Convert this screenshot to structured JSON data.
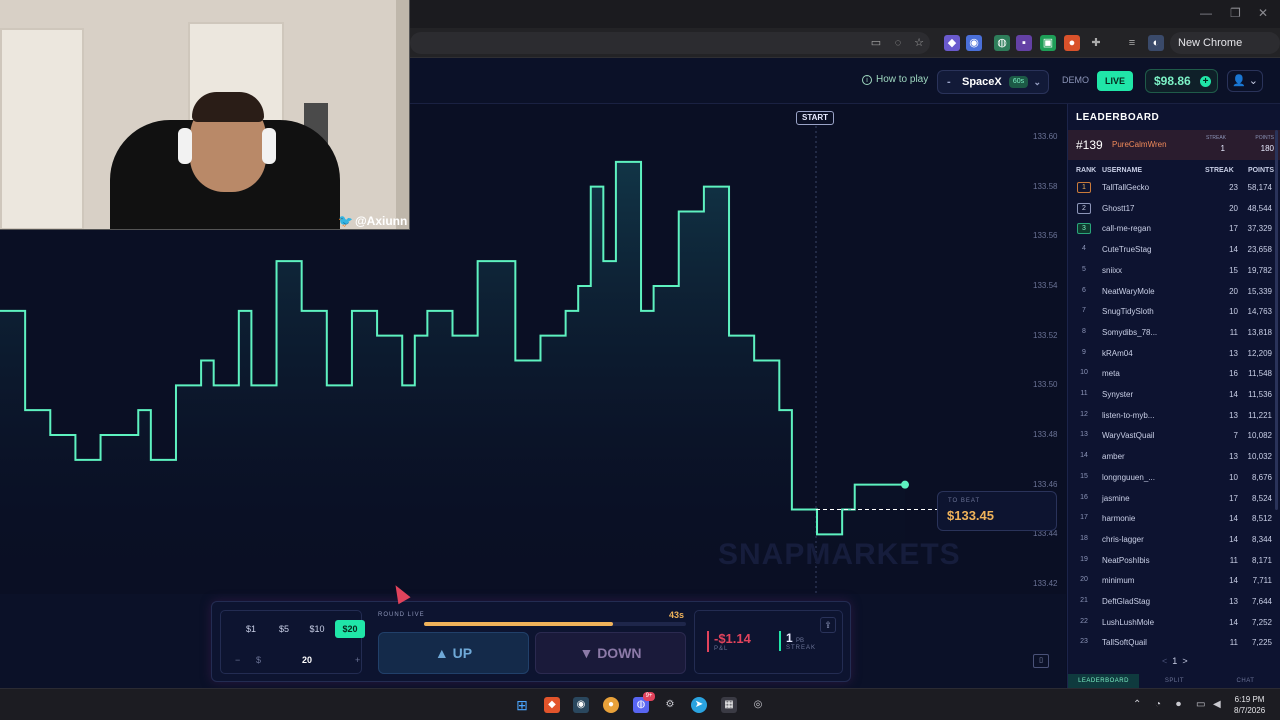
{
  "browser": {
    "new_chrome_label": "New Chrome available",
    "menu_glyph": "⋮"
  },
  "header": {
    "how_to_play": "How to play",
    "market": {
      "name": "SpaceX",
      "timeframe": "60s",
      "dash": "-",
      "chevron": "⌄"
    },
    "mode_demo": "DEMO",
    "mode_live": "LIVE",
    "balance": "$98.86",
    "balance_plus": "+",
    "profile_glyph": "👤 ⌄",
    "how_to_glyph": "i"
  },
  "chart": {
    "start_label": "START",
    "y_ticks": [
      "133.60",
      "133.58",
      "133.56",
      "133.54",
      "133.52",
      "133.50",
      "133.48",
      "133.46",
      "133.44",
      "133.42"
    ],
    "to_beat_label": "TO BEAT",
    "to_beat_value": "$133.45",
    "watermark": "SNAPMARKETS",
    "colors": {
      "line": "#5ef2c0",
      "area": "#0f2e3a",
      "target": "#ffffff"
    }
  },
  "chart_data": {
    "type": "line",
    "ylim": [
      133.42,
      133.6
    ],
    "series": [
      {
        "values": [
          133.53,
          133.53,
          133.49,
          133.49,
          133.48,
          133.48,
          133.47,
          133.47,
          133.48,
          133.48,
          133.48,
          133.49,
          133.47,
          133.47,
          133.5,
          133.5,
          133.51,
          133.5,
          133.5,
          133.53,
          133.5,
          133.5,
          133.55,
          133.55,
          133.53,
          133.53,
          133.5,
          133.5,
          133.53,
          133.53,
          133.52,
          133.52,
          133.5,
          133.52,
          133.53,
          133.53,
          133.52,
          133.52,
          133.55,
          133.55,
          133.55,
          133.51,
          133.51,
          133.52,
          133.52,
          133.53,
          133.54,
          133.58,
          133.55,
          133.59,
          133.59,
          133.53,
          133.54,
          133.54,
          133.57,
          133.57,
          133.58,
          133.58,
          133.52,
          133.52,
          133.51,
          133.51,
          133.49,
          133.45,
          133.45,
          133.44,
          133.44,
          133.45,
          133.46,
          133.46,
          133.46,
          133.46,
          133.46
        ]
      }
    ]
  },
  "webcam": {
    "handle": "@Axiunn",
    "bird": "🐦"
  },
  "trade": {
    "amounts": [
      "$1",
      "$5",
      "$10",
      "$20"
    ],
    "active_amount_index": 3,
    "stepper": {
      "minus": "−",
      "currency": "$",
      "value": "20",
      "plus": "+"
    },
    "round_label": "ROUND LIVE",
    "timer": "43s",
    "progress": 0.72,
    "up_label": "▲ UP",
    "down_label": "▼ DOWN",
    "pnl_value": "-$1.14",
    "pnl_label": "P&L",
    "streak_value": "1",
    "streak_unit": "PB",
    "streak_label": "STREAK",
    "share_glyph": "⇪",
    "panel_toggle_glyph": "▯"
  },
  "leaderboard": {
    "title": "LEADERBOARD",
    "me": {
      "rank": "#139",
      "username": "PureCalmWren",
      "streak_label": "STREAK",
      "streak": "1",
      "points_label": "POINTS",
      "points": "180"
    },
    "columns": [
      "RANK",
      "USERNAME",
      "STREAK",
      "POINTS"
    ],
    "rows": [
      {
        "rank": "1",
        "username": "TallTallGecko",
        "streak": "23",
        "points": "58,174"
      },
      {
        "rank": "2",
        "username": "Ghostt17",
        "streak": "20",
        "points": "48,544"
      },
      {
        "rank": "3",
        "username": "call-me-regan",
        "streak": "17",
        "points": "37,329"
      },
      {
        "rank": "4",
        "username": "CuteTrueStag",
        "streak": "14",
        "points": "23,658"
      },
      {
        "rank": "5",
        "username": "sniixx",
        "streak": "15",
        "points": "19,782"
      },
      {
        "rank": "6",
        "username": "NeatWaryMole",
        "streak": "20",
        "points": "15,339"
      },
      {
        "rank": "7",
        "username": "SnugTidySloth",
        "streak": "10",
        "points": "14,763"
      },
      {
        "rank": "8",
        "username": "Somydibs_78...",
        "streak": "11",
        "points": "13,818"
      },
      {
        "rank": "9",
        "username": "kRAm04",
        "streak": "13",
        "points": "12,209"
      },
      {
        "rank": "10",
        "username": "meta",
        "streak": "16",
        "points": "11,548"
      },
      {
        "rank": "11",
        "username": "Synyster",
        "streak": "14",
        "points": "11,536"
      },
      {
        "rank": "12",
        "username": "listen-to-myb...",
        "streak": "13",
        "points": "11,221"
      },
      {
        "rank": "13",
        "username": "WaryVastQuail",
        "streak": "7",
        "points": "10,082"
      },
      {
        "rank": "14",
        "username": "amber",
        "streak": "13",
        "points": "10,032"
      },
      {
        "rank": "15",
        "username": "longnguuen_...",
        "streak": "10",
        "points": "8,676"
      },
      {
        "rank": "16",
        "username": "jasmine",
        "streak": "17",
        "points": "8,524"
      },
      {
        "rank": "17",
        "username": "harmonie",
        "streak": "14",
        "points": "8,512"
      },
      {
        "rank": "18",
        "username": "chris-lagger",
        "streak": "14",
        "points": "8,344"
      },
      {
        "rank": "19",
        "username": "NeatPoshIbis",
        "streak": "11",
        "points": "8,171"
      },
      {
        "rank": "20",
        "username": "minimum",
        "streak": "14",
        "points": "7,711"
      },
      {
        "rank": "21",
        "username": "DeftGladStag",
        "streak": "13",
        "points": "7,644"
      },
      {
        "rank": "22",
        "username": "LushLushMole",
        "streak": "14",
        "points": "7,252"
      },
      {
        "rank": "23",
        "username": "TallSoftQuail",
        "streak": "11",
        "points": "7,225"
      }
    ],
    "pager": {
      "prev": "<",
      "page": "1",
      "next": ">"
    },
    "tabs": [
      "LEADERBOARD",
      "SPLIT",
      "CHAT"
    ],
    "active_tab": "LEADERBOARD"
  },
  "taskbar": {
    "time": "6:19 PM",
    "date": "8/7/2026",
    "badge": "9+"
  }
}
